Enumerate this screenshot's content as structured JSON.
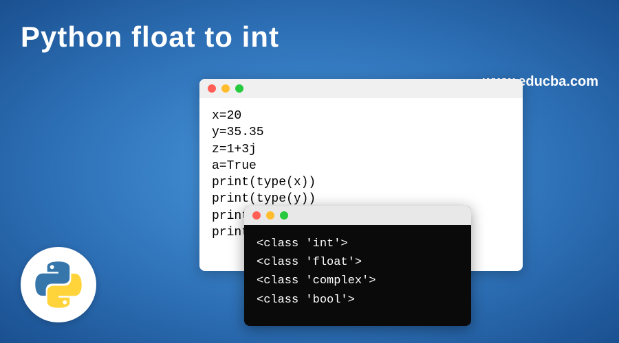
{
  "title": "Python float to int",
  "website": "www.educba.com",
  "code": {
    "lines": [
      "x=20",
      "y=35.35",
      "z=1+3j",
      "a=True",
      "print(type(x))",
      "print(type(y))",
      "print(type(z))",
      "print(type(a))"
    ]
  },
  "terminal": {
    "lines": [
      "<class 'int'>",
      "<class 'float'>",
      "<class 'complex'>",
      "<class 'bool'>"
    ]
  },
  "colors": {
    "bg_center": "#4a9ae0",
    "bg_edge": "#1a5090",
    "text_white": "#ffffff",
    "terminal_bg": "#0a0a0a"
  },
  "icons": {
    "logo": "python-logo"
  }
}
